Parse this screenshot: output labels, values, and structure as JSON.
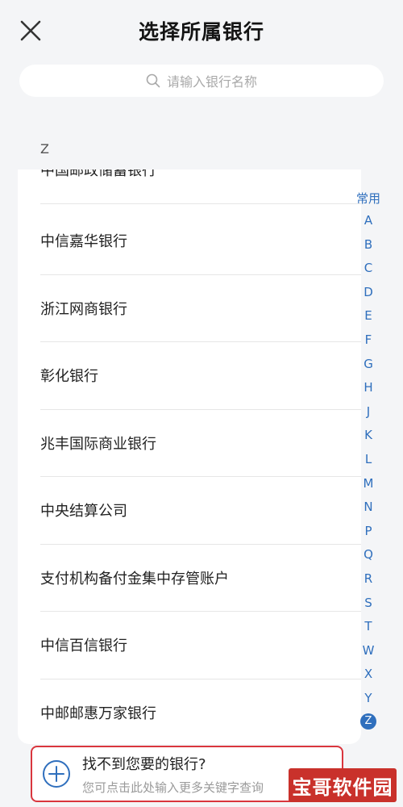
{
  "header": {
    "title": "选择所属银行",
    "close_icon": "close-icon"
  },
  "search": {
    "placeholder": "请输入银行名称",
    "icon": "search-icon"
  },
  "section": {
    "letter": "Z"
  },
  "banks": [
    "中国邮政储蓄银行",
    "中信嘉华银行",
    "浙江网商银行",
    "彰化银行",
    "兆丰国际商业银行",
    "中央结算公司",
    "支付机构备付金集中存管账户",
    "中信百信银行",
    "中邮邮惠万家银行"
  ],
  "index": {
    "common": "常用",
    "letters": [
      "A",
      "B",
      "C",
      "D",
      "E",
      "F",
      "G",
      "H",
      "J",
      "K",
      "L",
      "M",
      "N",
      "P",
      "Q",
      "R",
      "S",
      "T",
      "W",
      "X",
      "Y",
      "Z"
    ],
    "active": "Z",
    "active_color": "#2f6fbd"
  },
  "not_found": {
    "title": "找不到您要的银行?",
    "subtitle": "您可点击此处输入更多关键字查询",
    "icon": "plus-circle-icon",
    "border_color": "#d9363e"
  },
  "watermark": {
    "text": "宝哥软件园",
    "color": "#c9312b"
  }
}
